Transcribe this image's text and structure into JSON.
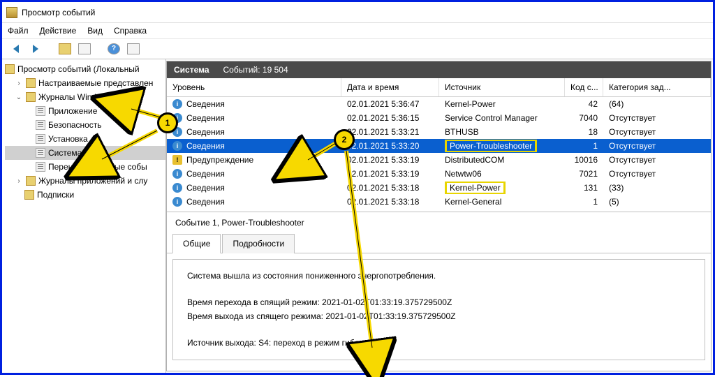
{
  "window": {
    "title": "Просмотр событий"
  },
  "menu": [
    "Файл",
    "Действие",
    "Вид",
    "Справка"
  ],
  "tree": {
    "root": "Просмотр событий (Локальный",
    "custom_views": "Настраиваемые представлен",
    "win_logs": "Журналы Windows",
    "items": [
      {
        "label": "Приложение"
      },
      {
        "label": "Безопасность"
      },
      {
        "label": "Установка"
      },
      {
        "label": "Система"
      },
      {
        "label": "Перенаправленные собы"
      }
    ],
    "app_logs": "Журналы приложений и слу",
    "subs": "Подписки"
  },
  "panel": {
    "title": "Система",
    "count_label": "Событий: 19 504"
  },
  "columns": [
    "Уровень",
    "Дата и время",
    "Источник",
    "Код с...",
    "Категория зад..."
  ],
  "rows": [
    {
      "level": "info",
      "lvl_text": "Сведения",
      "date": "02.01.2021 5:36:47",
      "src": "Kernel-Power",
      "code": "42",
      "cat": "(64)",
      "hl": false,
      "sel": false
    },
    {
      "level": "info",
      "lvl_text": "Сведения",
      "date": "02.01.2021 5:36:15",
      "src": "Service Control Manager",
      "code": "7040",
      "cat": "Отсутствует",
      "hl": false,
      "sel": false
    },
    {
      "level": "info",
      "lvl_text": "Сведения",
      "date": "02.01.2021 5:33:21",
      "src": "BTHUSB",
      "code": "18",
      "cat": "Отсутствует",
      "hl": false,
      "sel": false
    },
    {
      "level": "info",
      "lvl_text": "Сведения",
      "date": "02.01.2021 5:33:20",
      "src": "Power-Troubleshooter",
      "code": "1",
      "cat": "Отсутствует",
      "hl": true,
      "sel": true
    },
    {
      "level": "warn",
      "lvl_text": "Предупреждение",
      "date": "02.01.2021 5:33:19",
      "src": "DistributedCOM",
      "code": "10016",
      "cat": "Отсутствует",
      "hl": false,
      "sel": false
    },
    {
      "level": "info",
      "lvl_text": "Сведения",
      "date": "02.01.2021 5:33:19",
      "src": "Netwtw06",
      "code": "7021",
      "cat": "Отсутствует",
      "hl": false,
      "sel": false
    },
    {
      "level": "info",
      "lvl_text": "Сведения",
      "date": "02.01.2021 5:33:18",
      "src": "Kernel-Power",
      "code": "131",
      "cat": "(33)",
      "hl": true,
      "sel": false
    },
    {
      "level": "info",
      "lvl_text": "Сведения",
      "date": "02.01.2021 5:33:18",
      "src": "Kernel-General",
      "code": "1",
      "cat": "(5)",
      "hl": false,
      "sel": false
    }
  ],
  "details": {
    "title": "Событие 1, Power-Troubleshooter",
    "tabs": [
      "Общие",
      "Подробности"
    ],
    "line1": "Система вышла из состояния пониженного энергопотребления.",
    "line2": "Время перехода в спящий режим: 2021-01-02T01:33:19.375729500Z",
    "line3": "Время выхода из спящего режима: 2021-01-02T01:33:19.375729500Z",
    "line4": "Источник выхода: S4: переход в режим гибернации"
  },
  "badges": {
    "b1": "1",
    "b2": "2"
  }
}
